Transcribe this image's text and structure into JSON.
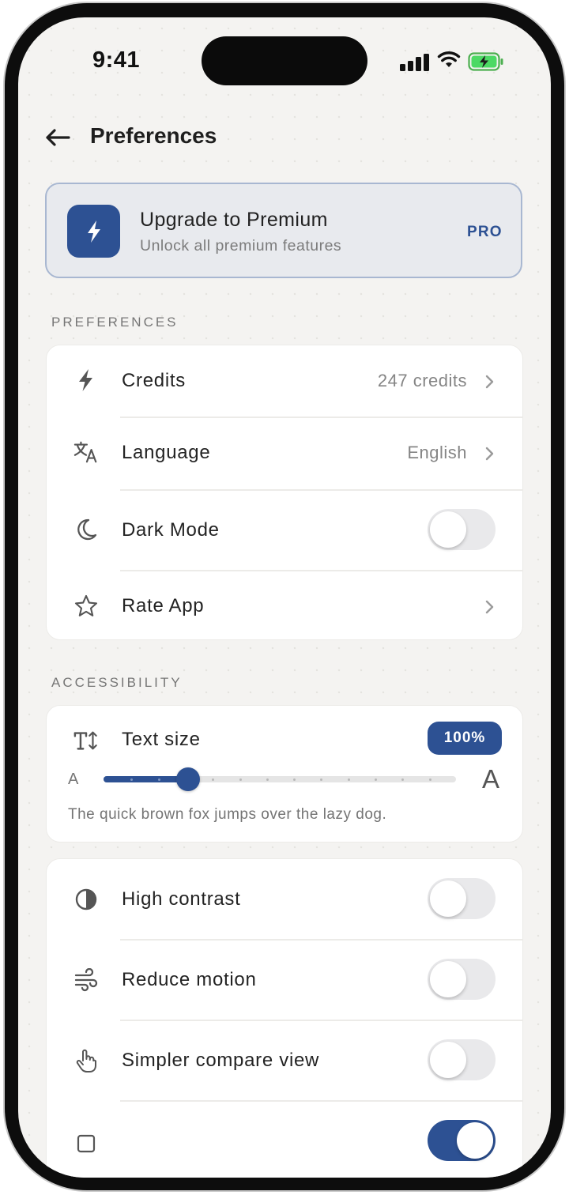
{
  "status_bar": {
    "time": "9:41"
  },
  "header": {
    "back_icon": "arrow-left-icon",
    "title": "Preferences"
  },
  "premium": {
    "title": "Upgrade to Premium",
    "subtitle": "Unlock all premium features",
    "badge": "PRO",
    "icon": "bolt-icon",
    "accent_color": "#2d5193"
  },
  "preferences_section": {
    "label": "PREFERENCES",
    "items": [
      {
        "icon": "bolt-icon",
        "label": "Credits",
        "value": "247 credits",
        "control": "chevron"
      },
      {
        "icon": "translate-icon",
        "label": "Language",
        "value": "English",
        "control": "chevron"
      },
      {
        "icon": "moon-icon",
        "label": "Dark Mode",
        "control": "toggle",
        "on": false
      },
      {
        "icon": "star-icon",
        "label": "Rate App",
        "control": "chevron"
      }
    ]
  },
  "accessibility_section": {
    "label": "ACCESSIBILITY",
    "text_size": {
      "icon": "text-size-icon",
      "label": "Text size",
      "percent_label": "100%",
      "small_a": "A",
      "large_a": "A",
      "slider_position": 0.24,
      "sample_text": "The quick brown fox jumps over the lazy dog."
    },
    "toggles": [
      {
        "icon": "contrast-icon",
        "label": "High contrast",
        "on": false
      },
      {
        "icon": "wind-icon",
        "label": "Reduce motion",
        "on": false
      },
      {
        "icon": "hand-pointer-icon",
        "label": "Simpler compare view",
        "on": false
      },
      {
        "icon": "",
        "label": "",
        "on": true
      }
    ]
  }
}
